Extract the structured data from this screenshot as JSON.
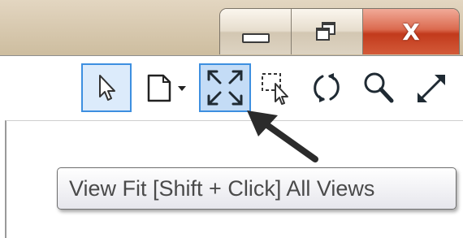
{
  "window": {
    "controls": {
      "minimize_icon": "minimize-icon",
      "restore_icon": "restore-icon",
      "close_glyph": "X"
    }
  },
  "toolbar": {
    "tools": [
      {
        "name": "select-tool",
        "icon": "cursor-arrow-icon",
        "state": "active"
      },
      {
        "name": "new-document-tool",
        "icon": "page-dropdown-icon",
        "state": "normal"
      },
      {
        "name": "view-fit-tool",
        "icon": "view-fit-icon",
        "state": "selected"
      },
      {
        "name": "zoom-window-tool",
        "icon": "zoom-window-icon",
        "state": "normal"
      },
      {
        "name": "rotate-tool",
        "icon": "rotate-icon",
        "state": "normal"
      },
      {
        "name": "zoom-tool",
        "icon": "magnifier-icon",
        "state": "normal"
      },
      {
        "name": "pan-tool",
        "icon": "diagonal-arrow-icon",
        "state": "normal"
      }
    ]
  },
  "tooltip": {
    "text": "View Fit [Shift + Click] All Views"
  },
  "colors": {
    "highlight_border": "#3d8fe0",
    "highlight_fill": "#c4dcf6",
    "close_button": "#c23a1c",
    "titlebar": "#d7c8ae"
  }
}
